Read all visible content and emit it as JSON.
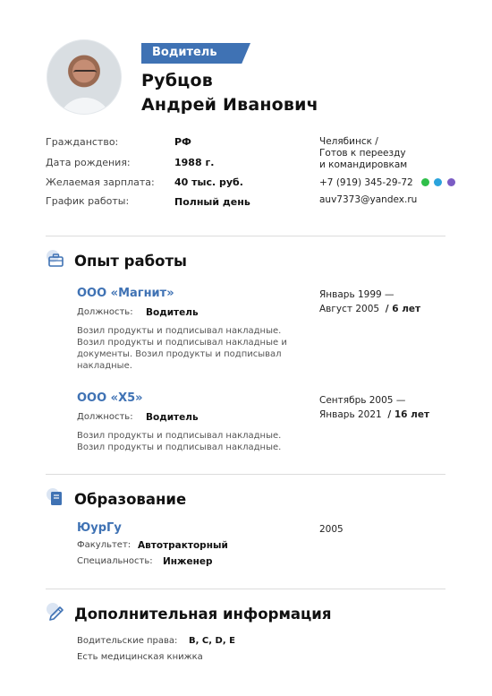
{
  "header": {
    "position_badge": "Водитель",
    "name_line1": "Рубцов",
    "name_line2": "Андрей Иванович"
  },
  "personal": [
    {
      "label": "Гражданство:",
      "value": "РФ"
    },
    {
      "label": "Дата рождения:",
      "value": "1988 г."
    },
    {
      "label": "Желаемая зарплата:",
      "value": "40 тыс. руб."
    },
    {
      "label": "График работы:",
      "value": "Полный день"
    }
  ],
  "contacts": {
    "city": "Челябинск /",
    "relocation_line1": "Готов к переезду",
    "relocation_line2": "и командировкам",
    "phone": "+7 (919) 345-29-72",
    "email": "auv7373@yandex.ru",
    "messenger_icons": [
      "whatsapp-icon",
      "telegram-icon",
      "viber-icon"
    ]
  },
  "experience": {
    "title": "Опыт работы",
    "jobs": [
      {
        "company": "ООО «Магнит»",
        "position_label": "Должность:",
        "position": "Водитель",
        "desc_lines": [
          "Возил продукты и подписывал накладные.",
          "Возил продукты и подписывал накладные и",
          "документы. Возил продукты и подписывал",
          "накладные."
        ],
        "period_line1": "Январь 1999 —",
        "period_line2": "Август 2005",
        "duration": "/ 6 лет"
      },
      {
        "company": "ООО «Х5»",
        "position_label": "Должность:",
        "position": "Водитель",
        "desc_lines": [
          "Возил продукты и подписывал накладные.",
          "Возил продукты и подписывал накладные."
        ],
        "period_line1": "Сентябрь 2005 —",
        "period_line2": "Январь 2021",
        "duration": "/ 16 лет"
      }
    ]
  },
  "education": {
    "title": "Образование",
    "institution": "ЮурГу",
    "year": "2005",
    "faculty_label": "Факультет:",
    "faculty": "Автотракторный",
    "speciality_label": "Специальность:",
    "speciality": "Инженер"
  },
  "additional": {
    "title": "Дополнительная информация",
    "license_label": "Водительские права:",
    "license": "B, C, D, E",
    "medical": "Есть медицинская книжка"
  },
  "colors": {
    "accent": "#3f72b4",
    "whatsapp": "#2fbf4a",
    "telegram": "#2aa3dc",
    "viber": "#7b5cc4"
  }
}
